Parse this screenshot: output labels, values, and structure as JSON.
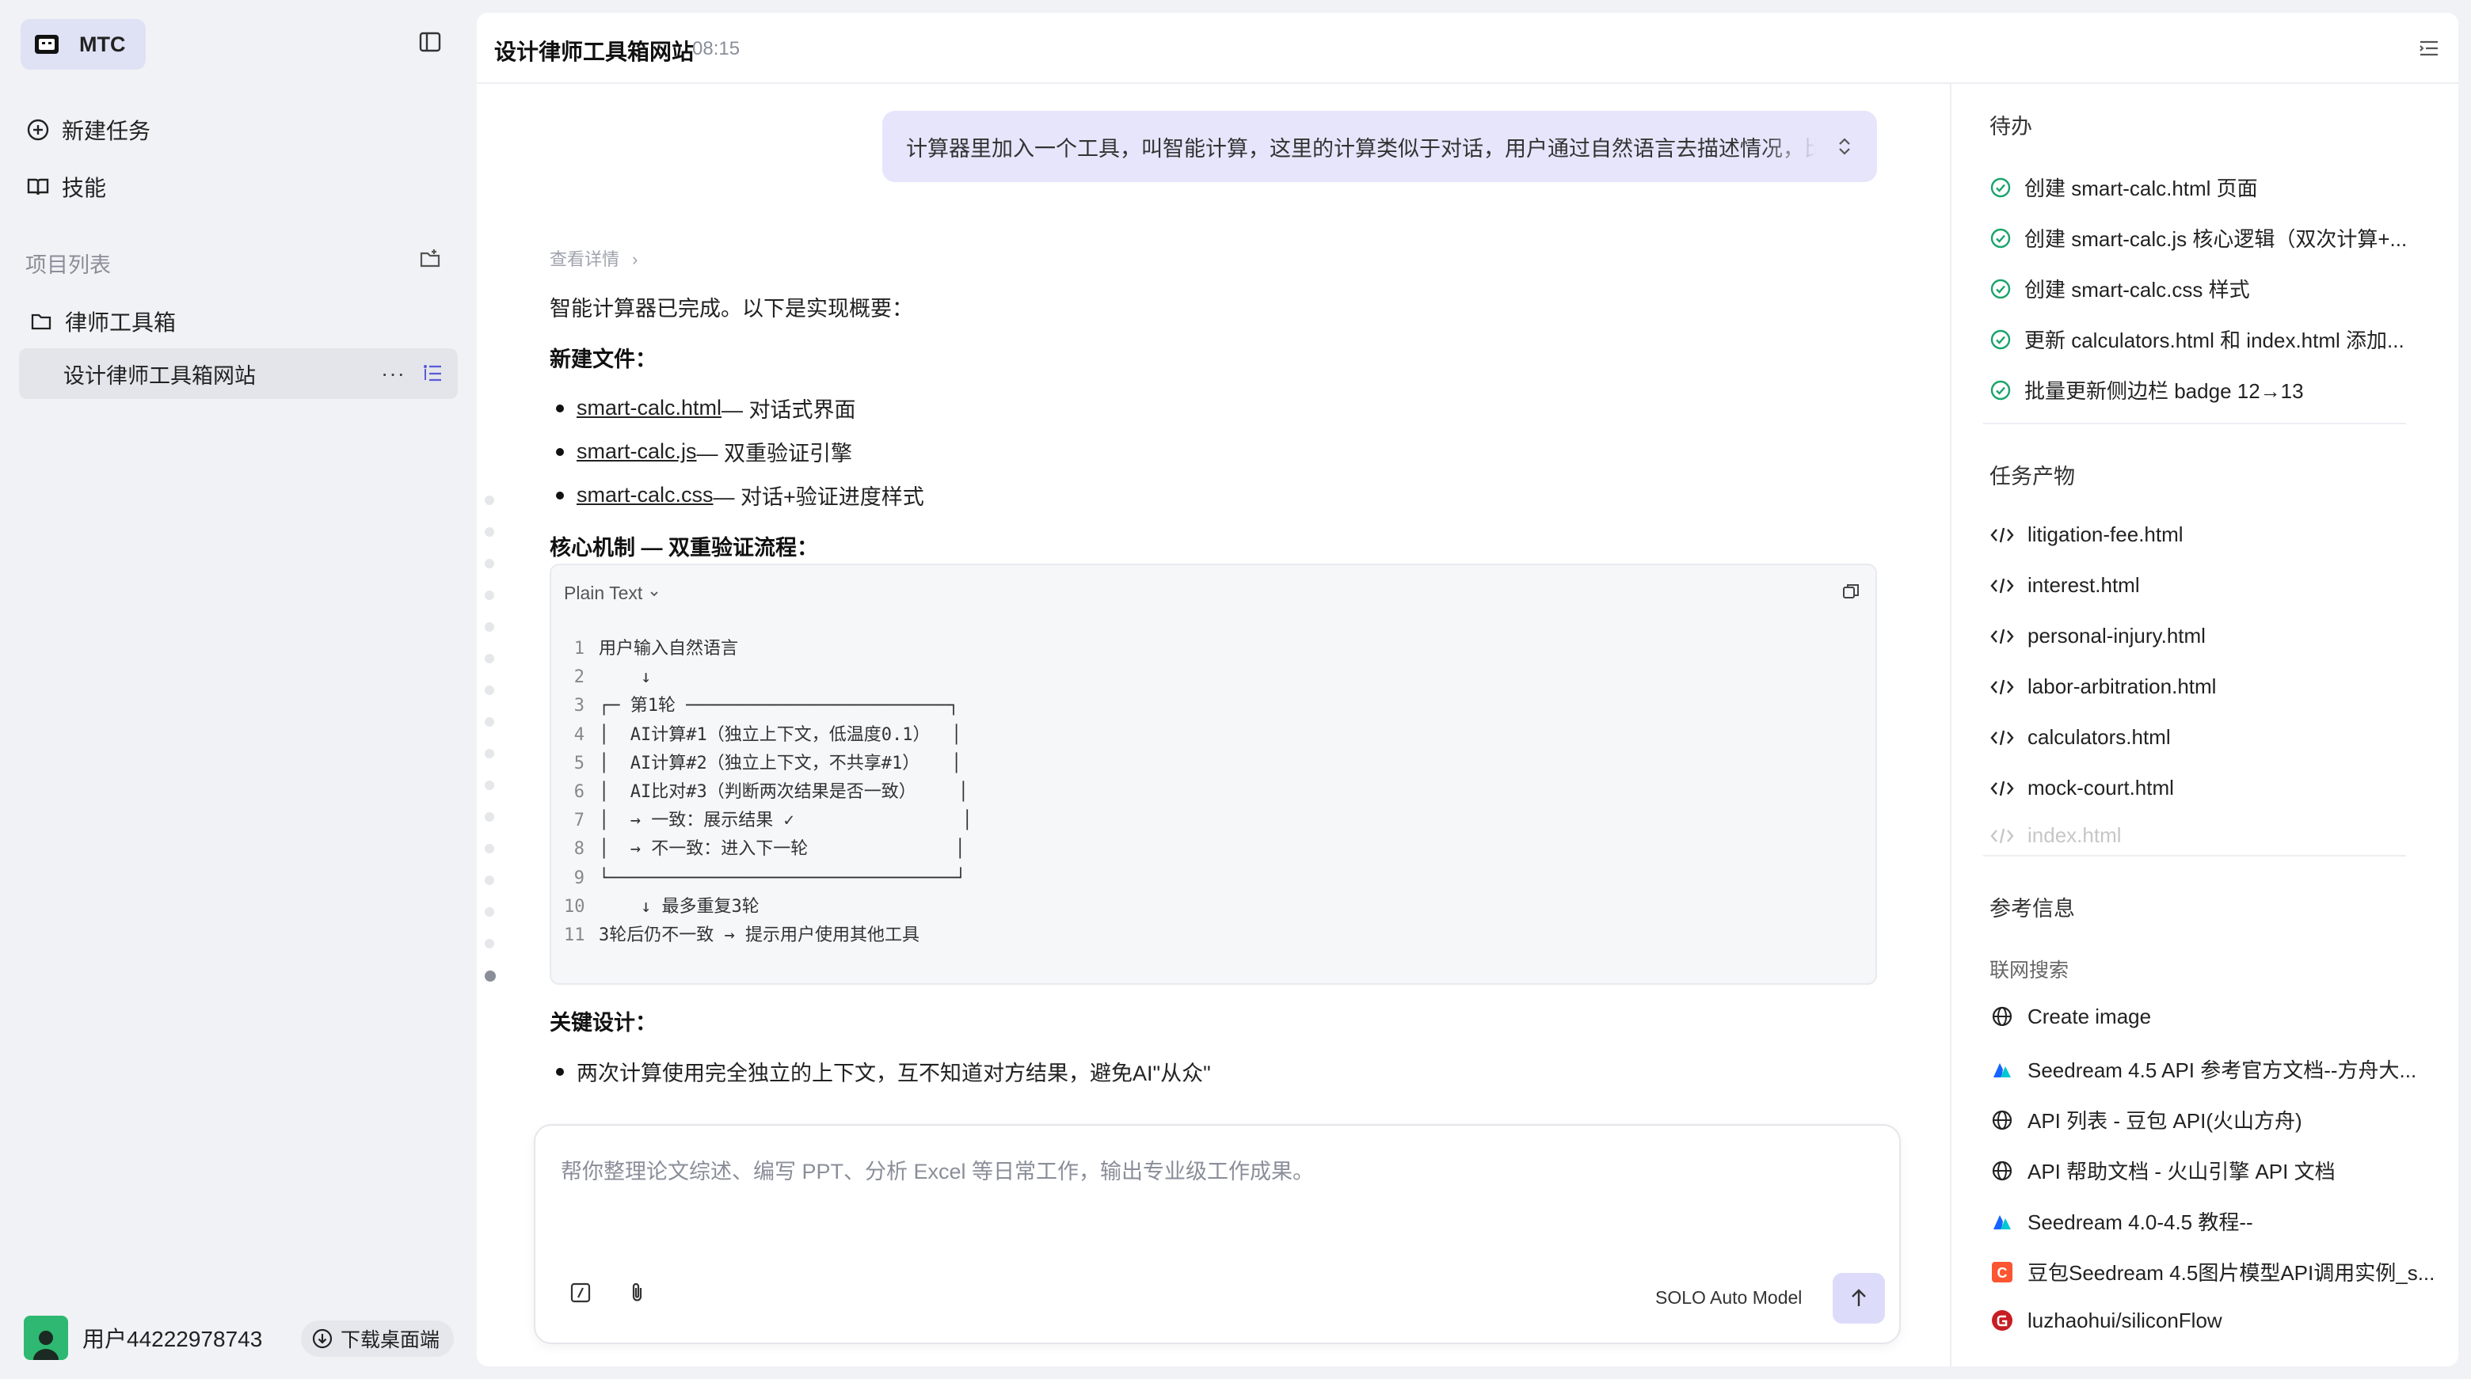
{
  "sidebar": {
    "brand": "MTC",
    "nav": [
      {
        "label": "新建任务",
        "icon": "new-task-icon"
      },
      {
        "label": "技能",
        "icon": "book-icon"
      }
    ],
    "projects_label": "项目列表",
    "project": {
      "name": "律师工具箱",
      "icon": "folder-icon"
    },
    "active_item": "设计律师工具箱网站",
    "item_more": "···",
    "user_name": "用户44222978743",
    "download_label": "下载桌面端"
  },
  "header": {
    "title": "设计律师工具箱网站",
    "time": "08:15"
  },
  "chat": {
    "user_message": "计算器里加入一个工具，叫智能计算，这里的计算类似于对话，用户通过自然语言去描述情况，比",
    "details_link": "查看详情",
    "intro": "智能计算器已完成。以下是实现概要：",
    "new_files_heading": "新建文件：",
    "files": [
      {
        "name": "smart-calc.html",
        "desc": " — 对话式界面"
      },
      {
        "name": "smart-calc.js",
        "desc": " — 双重验证引擎"
      },
      {
        "name": "smart-calc.css",
        "desc": " — 对话+验证进度样式"
      }
    ],
    "mechanism_heading": "核心机制 — 双重验证流程：",
    "code_lang": "Plain Text",
    "code_lines": [
      {
        "n": "1",
        "t": "用户输入自然语言"
      },
      {
        "n": "2",
        "t": "    ↓"
      },
      {
        "n": "3",
        "t": "┌─ 第1轮 ─────────────────────────┐"
      },
      {
        "n": "4",
        "t": "│  AI计算#1（独立上下文，低温度0.1）  │"
      },
      {
        "n": "5",
        "t": "│  AI计算#2（独立上下文，不共享#1）   │"
      },
      {
        "n": "6",
        "t": "│  AI比对#3（判断两次结果是否一致）    │"
      },
      {
        "n": "7",
        "t": "│  → 一致：展示结果 ✓                │"
      },
      {
        "n": "8",
        "t": "│  → 不一致：进入下一轮              │"
      },
      {
        "n": "9",
        "t": "└─────────────────────────────────┘"
      },
      {
        "n": "10",
        "t": "    ↓ 最多重复3轮"
      },
      {
        "n": "11",
        "t": "3轮后仍不一致 → 提示用户使用其他工具"
      }
    ],
    "key_heading": "关键设计：",
    "key_points": [
      "两次计算使用完全独立的上下文，互不知道对方结果，避免AI\"从众\""
    ]
  },
  "composer": {
    "placeholder": "帮你整理论文综述、编写 PPT、分析 Excel 等日常工作，输出专业级工作成果。",
    "model": "SOLO Auto Model"
  },
  "right_panel": {
    "todo_title": "待办",
    "todos": [
      "创建 smart-calc.html 页面",
      "创建 smart-calc.js 核心逻辑（双次计算+...",
      "创建 smart-calc.css 样式",
      "更新 calculators.html 和 index.html 添加...",
      "批量更新侧边栏 badge 12→13"
    ],
    "artifacts_title": "任务产物",
    "artifacts": [
      "litigation-fee.html",
      "interest.html",
      "personal-injury.html",
      "labor-arbitration.html",
      "calculators.html",
      "mock-court.html",
      "index.html"
    ],
    "refs_title": "参考信息",
    "web_search_label": "联网搜索",
    "refs": [
      {
        "label": "Create image",
        "icon": "globe-icon"
      },
      {
        "label": "Seedream 4.5 API 参考官方文档--方舟大...",
        "icon": "volcano-icon"
      },
      {
        "label": "API 列表 - 豆包 API(火山方舟)",
        "icon": "globe-icon"
      },
      {
        "label": "API 帮助文档 - 火山引擎 API 文档",
        "icon": "globe-icon"
      },
      {
        "label": "Seedream 4.0-4.5 教程--",
        "icon": "volcano-icon"
      },
      {
        "label": "豆包Seedream 4.5图片模型API调用实例_s...",
        "icon": "csdn-icon"
      },
      {
        "label": "luzhaohui/siliconFlow",
        "icon": "gitee-icon"
      }
    ]
  },
  "colors": {
    "accent": "#6c63ff",
    "check_green": "#1aa36b",
    "user_bubble": "#e7e5fb",
    "send_button": "#dcdcfa"
  }
}
